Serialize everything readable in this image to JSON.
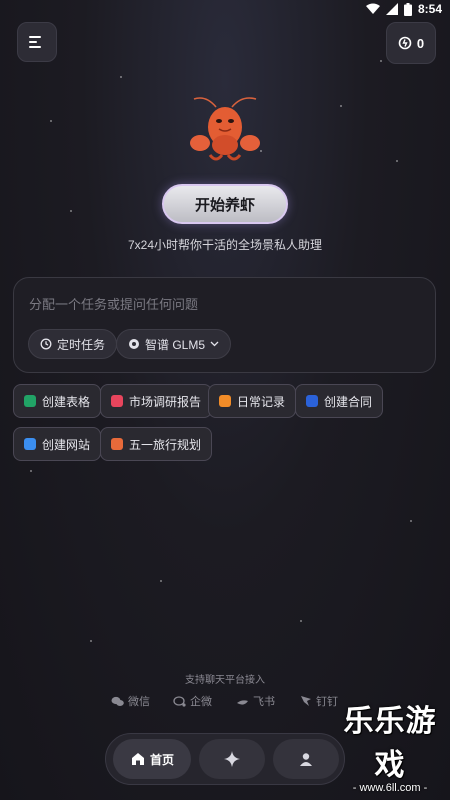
{
  "status_bar": {
    "time": "8:54",
    "icons": [
      "wifi-icon",
      "cellular-signal-icon",
      "battery-icon"
    ]
  },
  "header": {
    "menu_icon": "menu-icon",
    "credits": {
      "icon": "credit-icon",
      "count": "0"
    }
  },
  "hero": {
    "start_button_label": "开始养虾",
    "tagline": "7x24小时帮你干活的全场景私人助理"
  },
  "composer": {
    "placeholder": "分配一个任务或提问任何问题",
    "scheduled_task_label": "定时任务",
    "model_label": "智谱 GLM5"
  },
  "quick_tools": [
    {
      "label": "创建表格",
      "icon": "spreadsheet-icon",
      "color": "#21a366"
    },
    {
      "label": "市场调研报告",
      "icon": "report-icon",
      "color": "#e8455d"
    },
    {
      "label": "日常记录",
      "icon": "notes-icon",
      "color": "#f28c28"
    },
    {
      "label": "创建合同",
      "icon": "word-doc-icon",
      "color": "#2b62d9"
    },
    {
      "label": "创建网站",
      "icon": "website-icon",
      "color": "#3b8ef0"
    },
    {
      "label": "五一旅行规划",
      "icon": "travel-icon",
      "color": "#e86a3a"
    }
  ],
  "platforms": {
    "title": "支持聊天平台接入",
    "items": [
      {
        "label": "微信",
        "icon": "wechat-icon"
      },
      {
        "label": "企微",
        "icon": "wecom-icon"
      },
      {
        "label": "飞书",
        "icon": "feishu-icon"
      },
      {
        "label": "钉钉",
        "icon": "dingtalk-icon"
      }
    ]
  },
  "bottom_nav": {
    "home_label": "首页",
    "items": [
      "home-icon",
      "sparkle-icon",
      "user-icon"
    ]
  },
  "watermark": {
    "title": "乐乐游戏",
    "url": "- www.6ll.com -"
  }
}
